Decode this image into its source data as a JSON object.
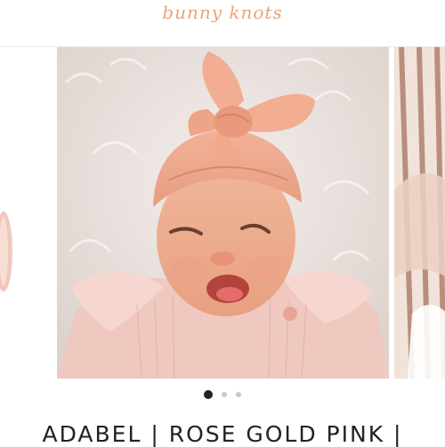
{
  "brand": {
    "logo_text": "bunny knots",
    "color": "#e9a37c"
  },
  "carousel": {
    "slides": [
      {
        "name": "previous-product-photo"
      },
      {
        "name": "baby-rose-headwrap-photo"
      },
      {
        "name": "next-product-photo"
      }
    ],
    "zoom_icon": "magnifier-icon",
    "dots": {
      "count": 3,
      "active_index": 0
    }
  },
  "product": {
    "title": "ADABEL | ROSE GOLD PINK |"
  }
}
